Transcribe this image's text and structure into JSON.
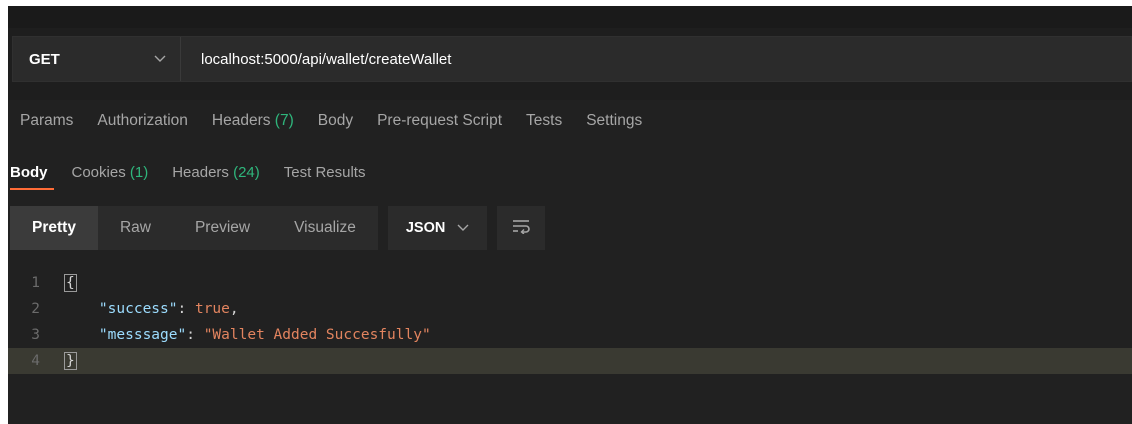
{
  "request": {
    "method": "GET",
    "url": "localhost:5000/api/wallet/createWallet"
  },
  "request_tabs": [
    {
      "label": "Params"
    },
    {
      "label": "Authorization"
    },
    {
      "label": "Headers",
      "count": "(7)"
    },
    {
      "label": "Body"
    },
    {
      "label": "Pre-request Script"
    },
    {
      "label": "Tests"
    },
    {
      "label": "Settings"
    }
  ],
  "response_tabs": [
    {
      "label": "Body",
      "active": true
    },
    {
      "label": "Cookies",
      "count": "(1)"
    },
    {
      "label": "Headers",
      "count": "(24)"
    },
    {
      "label": "Test Results"
    }
  ],
  "view_modes": [
    "Pretty",
    "Raw",
    "Preview",
    "Visualize"
  ],
  "active_view_mode": "Pretty",
  "format_select": "JSON",
  "icons": {
    "method_dropdown": "chevron-down-icon",
    "format_dropdown": "chevron-down-icon",
    "wrap": "wrap-lines-icon"
  },
  "response_body": {
    "line_numbers": [
      "1",
      "2",
      "3",
      "4"
    ],
    "open_brace": "{",
    "close_brace": "}",
    "lines": [
      {
        "key": "\"success\"",
        "sep": ": ",
        "value": "true",
        "tail": ","
      },
      {
        "key": "\"messsage\"",
        "sep": ": ",
        "value": "\"Wallet Added Succesfully\"",
        "tail": ""
      }
    ]
  },
  "colors": {
    "accent": "#ff6c37",
    "count_green": "#2fb67c",
    "json_key": "#9cdcfe",
    "json_value": "#e2845f"
  }
}
